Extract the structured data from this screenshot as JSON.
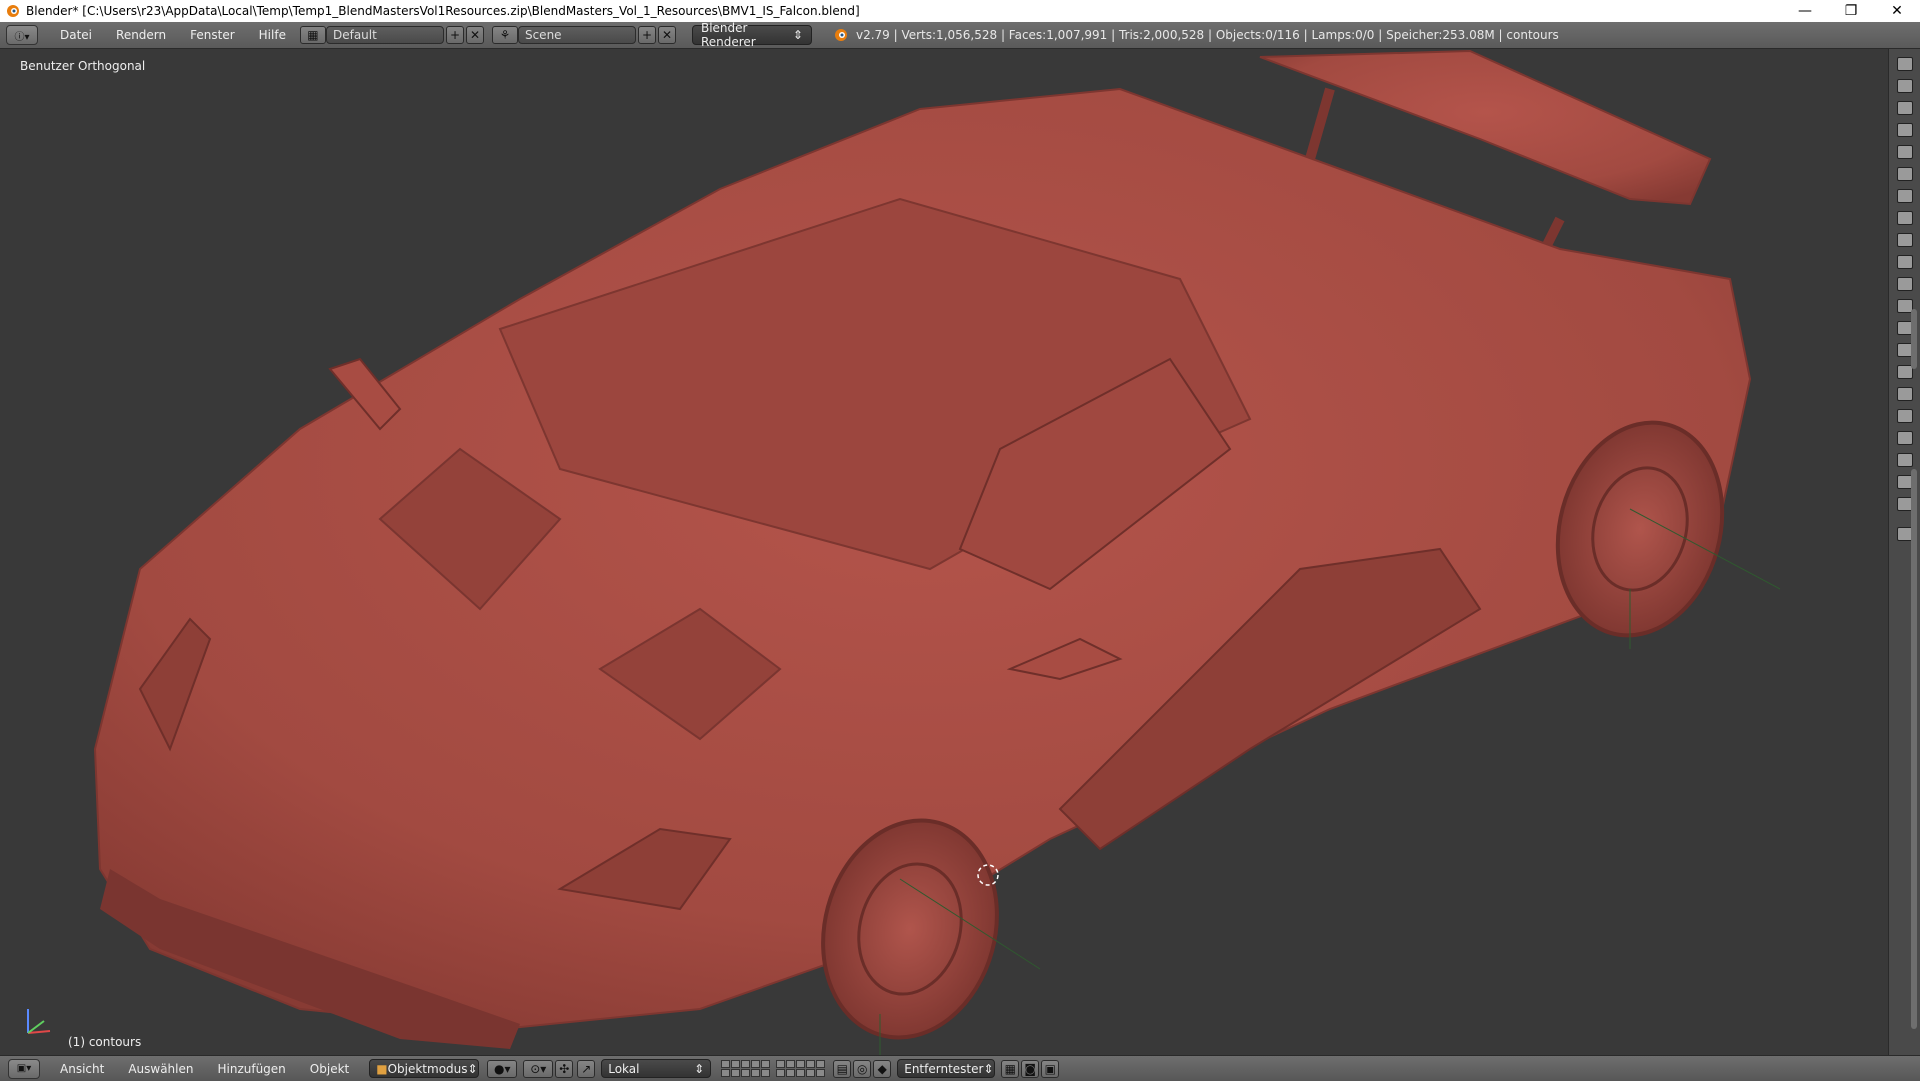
{
  "window": {
    "title": "Blender* [C:\\Users\\r23\\AppData\\Local\\Temp\\Temp1_BlendMastersVol1Resources.zip\\BlendMasters_Vol_1_Resources\\BMV1_IS_Falcon.blend]",
    "minimize": "—",
    "maximize": "❐",
    "close": "✕"
  },
  "infobar": {
    "menus": [
      "Datei",
      "Rendern",
      "Fenster",
      "Hilfe"
    ],
    "screen_layout": "Default",
    "scene": "Scene",
    "renderer": "Blender Renderer",
    "stats": "v2.79 | Verts:1,056,528 | Faces:1,007,991 | Tris:2,000,528 | Objects:0/116 | Lamps:0/0 | Speicher:253.08M | contours"
  },
  "viewport": {
    "view_label": "Benutzer Orthogonal",
    "object_label": "(1) contours",
    "model_color": "#a64a42",
    "background_color": "#393939"
  },
  "bottombar": {
    "menus": [
      "Ansicht",
      "Auswählen",
      "Hinzufügen",
      "Objekt"
    ],
    "mode": "Objektmodus",
    "pivot": "Lokal",
    "snap": "Entferntester"
  }
}
